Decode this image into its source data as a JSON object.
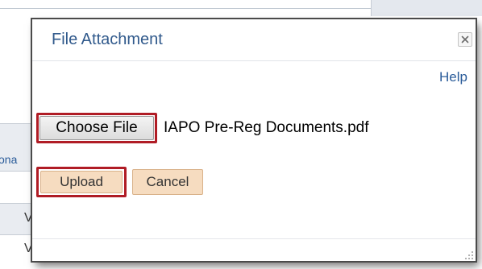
{
  "background": {
    "tab_fragment": "ona",
    "column_fragment_1": "V",
    "column_fragment_2": "V"
  },
  "dialog": {
    "title": "File Attachment",
    "help_label": "Help",
    "choose_file_label": "Choose File",
    "selected_file_name": "IAPO Pre-Reg Documents.pdf",
    "upload_label": "Upload",
    "cancel_label": "Cancel"
  },
  "icons": {
    "close": "close-icon",
    "resize": "resize-grip-icon"
  },
  "colors": {
    "title": "#315a8c",
    "link": "#2b5c9a",
    "highlight_outline": "#b01c25",
    "action_button_bg": "#f6dcc0"
  }
}
